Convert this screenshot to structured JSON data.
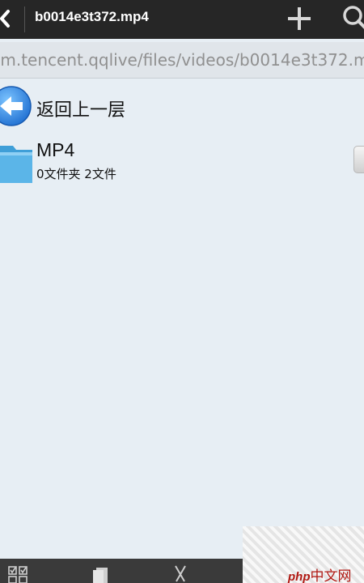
{
  "titlebar": {
    "title": "b0014e3t372.mp4",
    "back_icon": "back-arrow-icon",
    "add_icon": "plus-icon",
    "search_icon": "search-icon"
  },
  "pathbar": {
    "path": ".m.tencent.qqlive/files/videos/b0014e3t372.mp4"
  },
  "list": {
    "up_label": "返回上一层",
    "items": [
      {
        "name": "MP4",
        "info": "0文件夹  2文件"
      }
    ]
  },
  "bottombar": {
    "icons": [
      "select-all-icon",
      "copy-icon",
      "cut-icon"
    ]
  },
  "watermark": {
    "brand": "php",
    "suffix": "中文网"
  },
  "colors": {
    "topbar": "#262626",
    "background": "#e7eef4",
    "folder": "#5bb5e8",
    "up_button": "#3a8fe0"
  }
}
